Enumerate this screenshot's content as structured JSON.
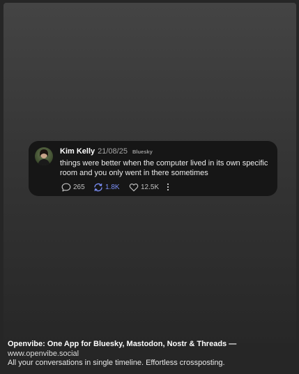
{
  "post": {
    "author_name": "Kim Kelly",
    "date": "21/08/25",
    "source": "Bluesky",
    "text": "things were better when the computer lived in its own specific room and you only went in there sometimes",
    "replies": "265",
    "reposts": "1.8K",
    "likes": "12.5K",
    "icons": [
      "reply-icon",
      "repost-icon",
      "like-icon",
      "more-icon"
    ],
    "repost_color": "#7b8ff7"
  },
  "footer": {
    "title": "Openvibe: One App for Bluesky, Mastodon, Nostr & Threads —",
    "url": "www.openvibe.social",
    "tagline": "All your conversations in single timeline. Effortless crossposting."
  }
}
